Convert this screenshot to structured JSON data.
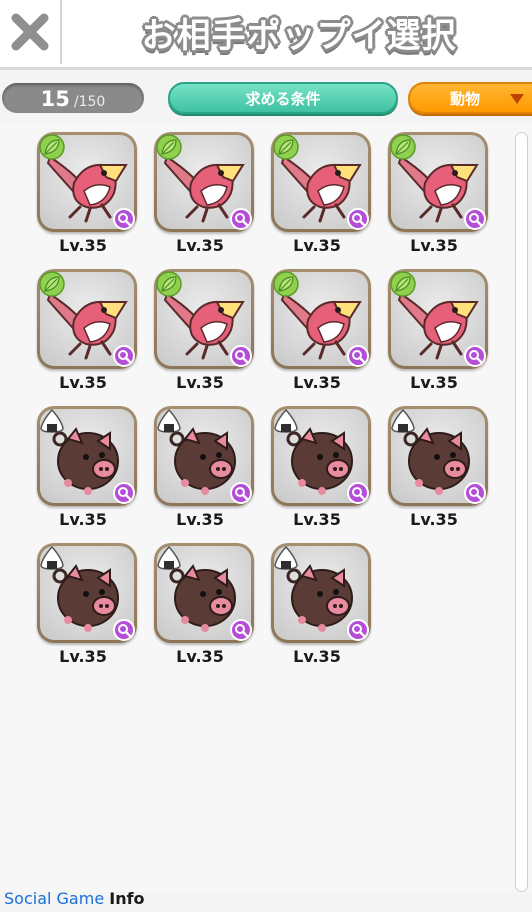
{
  "header": {
    "title": "お相手ポップイ選択"
  },
  "toolbar": {
    "count_current": "15",
    "count_max": "/150",
    "condition_label": "求める条件",
    "filter_label": "動物"
  },
  "cards": [
    {
      "type": "bird",
      "level": "Lv.35"
    },
    {
      "type": "bird",
      "level": "Lv.35"
    },
    {
      "type": "bird",
      "level": "Lv.35"
    },
    {
      "type": "bird",
      "level": "Lv.35"
    },
    {
      "type": "bird",
      "level": "Lv.35"
    },
    {
      "type": "bird",
      "level": "Lv.35"
    },
    {
      "type": "bird",
      "level": "Lv.35"
    },
    {
      "type": "bird",
      "level": "Lv.35"
    },
    {
      "type": "pig",
      "level": "Lv.35"
    },
    {
      "type": "pig",
      "level": "Lv.35"
    },
    {
      "type": "pig",
      "level": "Lv.35"
    },
    {
      "type": "pig",
      "level": "Lv.35"
    },
    {
      "type": "pig",
      "level": "Lv.35"
    },
    {
      "type": "pig",
      "level": "Lv.35"
    },
    {
      "type": "pig",
      "level": "Lv.35"
    }
  ],
  "icons": {
    "close": "close-icon",
    "bird_badge": "leaf-badge-icon",
    "pig_badge": "onigiri-badge-icon",
    "magnify": "magnifier-icon"
  },
  "colors": {
    "condition_button": "#3fc2a2",
    "filter_button": "#ff9900",
    "magnifier": "#b44ed8"
  },
  "watermark": {
    "brand": "Social Game",
    "suffix": "Info"
  }
}
